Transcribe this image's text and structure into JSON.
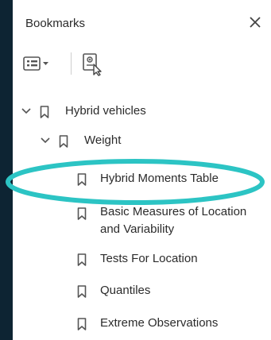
{
  "panel": {
    "title": "Bookmarks",
    "close_glyph": "✕"
  },
  "toolbar": {
    "options_icon": "options-list-icon",
    "new_bookmark_icon": "new-bookmark-icon"
  },
  "bookmarks": [
    {
      "label": "Hybrid vehicles",
      "level": 0,
      "expanded": true
    },
    {
      "label": "Weight",
      "level": 1,
      "expanded": true
    },
    {
      "label": "Hybrid Moments Table",
      "level": 2,
      "selected": true
    },
    {
      "label": "Basic Measures of Location and Variability",
      "level": 2
    },
    {
      "label": "Tests For Location",
      "level": 2
    },
    {
      "label": "Quantiles",
      "level": 2
    },
    {
      "label": "Extreme Observations",
      "level": 2
    }
  ],
  "colors": {
    "background": "#0d2433",
    "highlight_ring": "#2cc4c4",
    "text": "#2b2b2b",
    "icon": "#555555"
  }
}
